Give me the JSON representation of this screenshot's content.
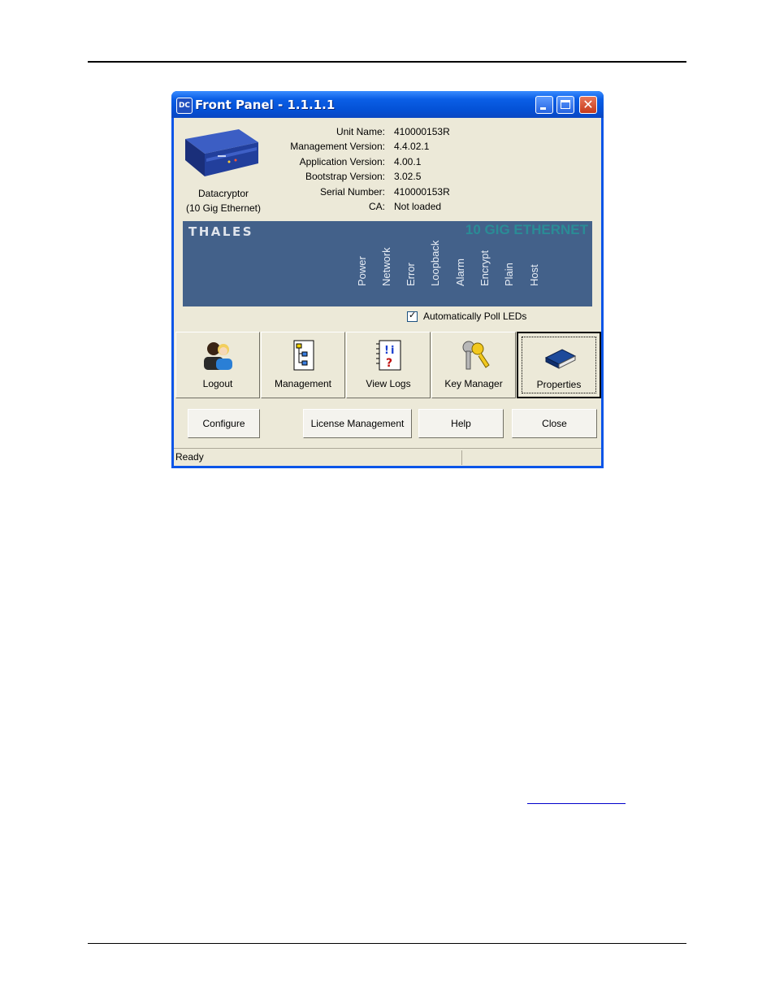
{
  "window": {
    "app_icon": "datacryptor-icon",
    "title": "Front Panel - 1.1.1.1"
  },
  "device": {
    "caption_line1": "Datacryptor",
    "caption_line2": "(10 Gig Ethernet)"
  },
  "info": {
    "labels": [
      "Unit Name:",
      "Management Version:",
      "Application Version:",
      "Bootstrap Version:",
      "Serial Number:",
      "CA:"
    ],
    "values": [
      "410000153R",
      "4.4.02.1",
      "4.00.1",
      "3.02.5",
      "410000153R",
      "Not loaded"
    ]
  },
  "led_panel": {
    "brand": "THALES",
    "product": "10 GIG ETHERNET",
    "leds": [
      "Power",
      "Network",
      "Error",
      "Loopback",
      "Alarm",
      "Encrypt",
      "Plain",
      "Host"
    ],
    "colors": {
      "panel": "#43618a",
      "product_text": "#2a8c96"
    }
  },
  "poll": {
    "label": "Automatically Poll LEDs",
    "checked": true
  },
  "toolbar": {
    "buttons": [
      {
        "label": "Logout",
        "icon": "users-icon"
      },
      {
        "label": "Management",
        "icon": "tree-icon"
      },
      {
        "label": "View Logs",
        "icon": "log-book-icon"
      },
      {
        "label": "Key Manager",
        "icon": "keys-icon"
      },
      {
        "label": "Properties",
        "icon": "book-icon"
      }
    ]
  },
  "actions": {
    "configure": "Configure",
    "license": "License Management",
    "help": "Help",
    "close": "Close"
  },
  "status_bar": {
    "text": "Ready"
  }
}
